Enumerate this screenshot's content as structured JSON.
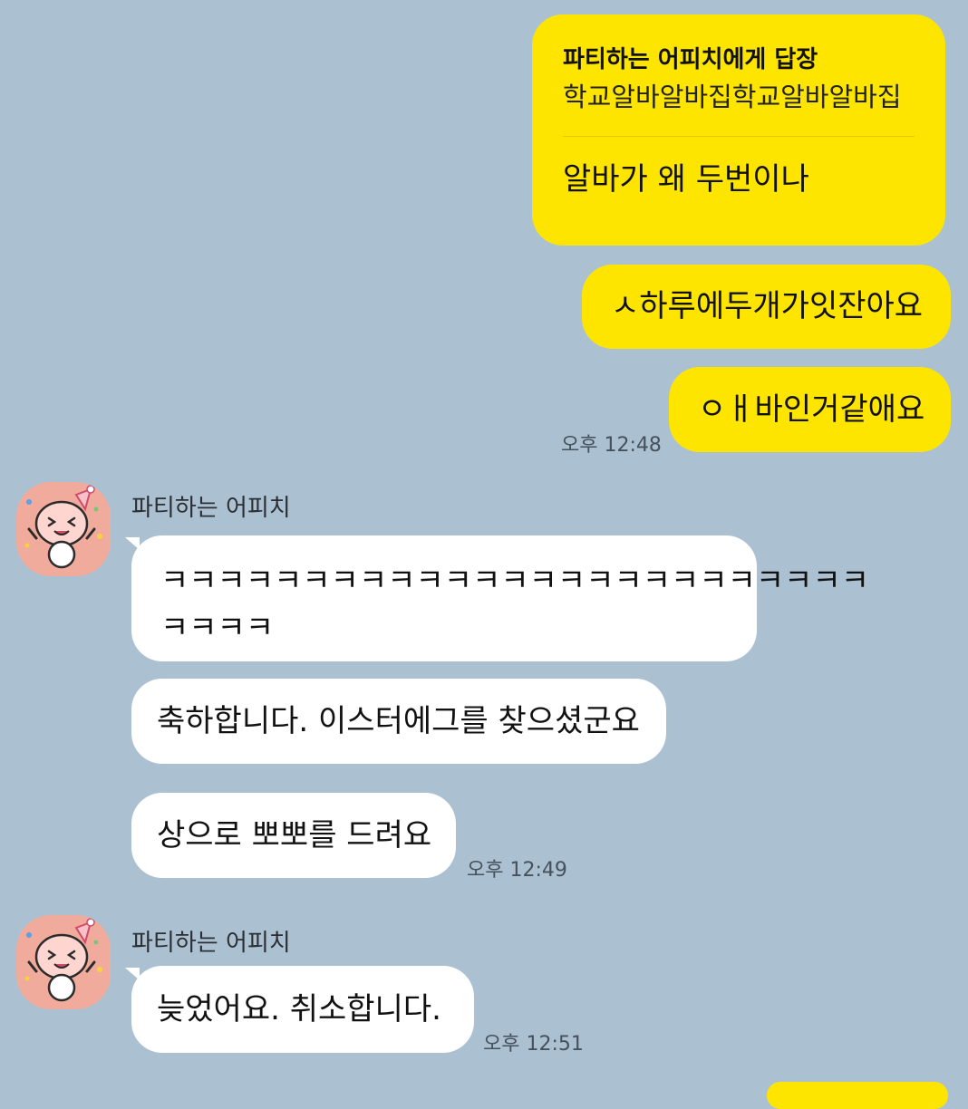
{
  "colors": {
    "background": "#abc1d2",
    "my_bubble": "#fee500",
    "other_bubble": "#ffffff",
    "avatar_bg": "#f1ab9c"
  },
  "outgoing": {
    "reply": {
      "target": "파티하는 어피치에게 답장",
      "quoted": "학교알바알바집학교알바알바집",
      "text": "알바가 왜 두번이나"
    },
    "messages": [
      "ㅅ하루에두개가잇잔아요",
      "ㅇㅐ바인거같애요"
    ],
    "time": "오후 12:48"
  },
  "incoming_groups": [
    {
      "sender": "파티하는 어피치",
      "avatar_icon": "apeach-party-hat-icon",
      "messages": [
        "ㅋㅋㅋㅋㅋㅋㅋㅋㅋㅋㅋㅋㅋㅋㅋㅋㅋㅋㅋㅋㅋㅋㅋㅋㅋ",
        "ㅋㅋㅋㅋ",
        "축하합니다. 이스터에그를 찾으셨군요",
        "상으로 뽀뽀를 드려요"
      ],
      "time": "오후 12:49"
    },
    {
      "sender": "파티하는 어피치",
      "avatar_icon": "apeach-party-hat-icon",
      "messages": [
        "늦었어요. 취소합니다."
      ],
      "time": "오후 12:51"
    }
  ]
}
